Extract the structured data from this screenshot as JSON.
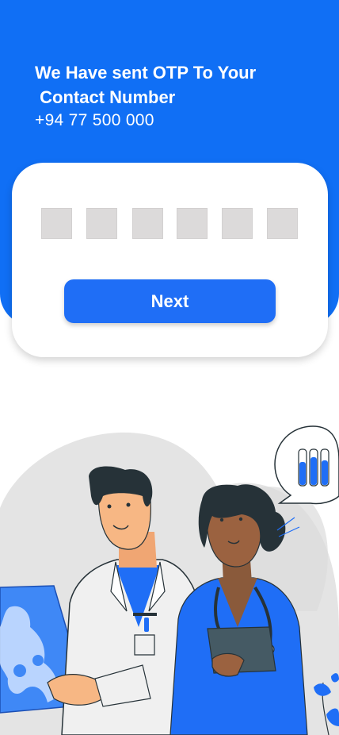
{
  "header": {
    "message": "We Have sent OTP To Your\n Contact Number",
    "phone_number": "+94 77 500 000"
  },
  "otp": {
    "digits": [
      "",
      "",
      "",
      "",
      "",
      ""
    ]
  },
  "actions": {
    "next_label": "Next"
  },
  "colors": {
    "primary": "#106ff5",
    "button": "#1f6ef6",
    "otp_box": "#dcdada",
    "card": "#ffffff"
  },
  "illustration": {
    "subject": "doctor-and-nurse-illustration"
  }
}
